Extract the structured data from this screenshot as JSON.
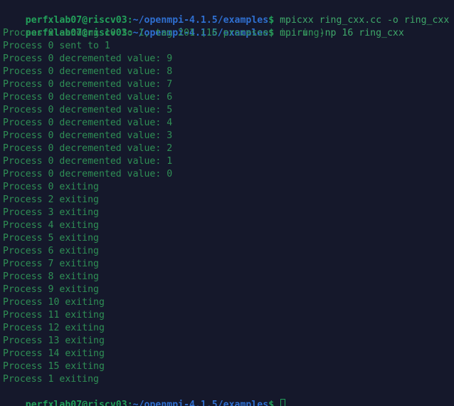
{
  "terminal": {
    "background_color": "#15182b",
    "prompt_user_color": "#22a05a",
    "prompt_path_color": "#2f6fd0",
    "command_color": "#3fa86a",
    "output_color": "#2f8f55",
    "cursor_color": "#22a05a",
    "prompt": {
      "user_host": "perfxlab07@riscv03",
      "separator": ":",
      "path": "~/openmpi-4.1.5/examples",
      "sigil": "$"
    },
    "commands": {
      "compile": " mpicxx ring_cxx.cc -o ring_cxx",
      "run": " mpirun -np 16 ring_cxx"
    },
    "output_lines": [
      "Process 0 sending 10 to 1, tag 201 (16 processes in ring)",
      "Process 0 sent to 1",
      "Process 0 decremented value: 9",
      "Process 0 decremented value: 8",
      "Process 0 decremented value: 7",
      "Process 0 decremented value: 6",
      "Process 0 decremented value: 5",
      "Process 0 decremented value: 4",
      "Process 0 decremented value: 3",
      "Process 0 decremented value: 2",
      "Process 0 decremented value: 1",
      "Process 0 decremented value: 0",
      "Process 0 exiting",
      "Process 2 exiting",
      "Process 3 exiting",
      "Process 4 exiting",
      "Process 5 exiting",
      "Process 6 exiting",
      "Process 7 exiting",
      "Process 8 exiting",
      "Process 9 exiting",
      "Process 10 exiting",
      "Process 11 exiting",
      "Process 12 exiting",
      "Process 13 exiting",
      "Process 14 exiting",
      "Process 15 exiting",
      "Process 1 exiting"
    ]
  }
}
